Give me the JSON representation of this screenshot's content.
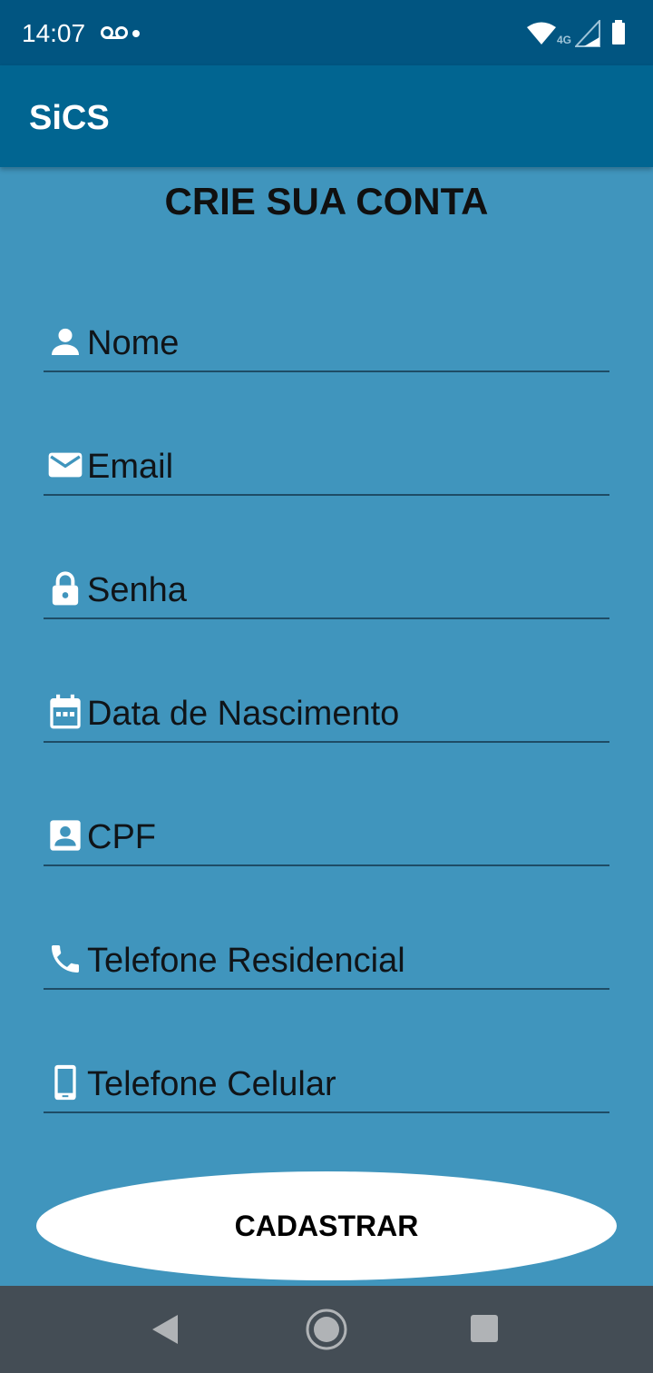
{
  "status_bar": {
    "time": "14:07",
    "network_label": "4G",
    "icons": [
      "voicemail-icon",
      "notification-dot",
      "wifi-icon",
      "signal-icon",
      "battery-icon"
    ]
  },
  "app_bar": {
    "title": "SiCS"
  },
  "form": {
    "heading": "CRIE SUA CONTA",
    "fields": [
      {
        "label": "Nome",
        "icon": "person-icon"
      },
      {
        "label": "Email",
        "icon": "email-icon"
      },
      {
        "label": "Senha",
        "icon": "lock-icon"
      },
      {
        "label": "Data de Nascimento",
        "icon": "calendar-icon"
      },
      {
        "label": "CPF",
        "icon": "id-card-icon"
      },
      {
        "label": "Telefone Residencial",
        "icon": "phone-icon"
      },
      {
        "label": "Telefone Celular",
        "icon": "smartphone-icon"
      }
    ],
    "submit_label": "CADASTRAR"
  },
  "nav_bar": {
    "icons": [
      "back-icon",
      "home-icon",
      "recents-icon"
    ]
  },
  "colors": {
    "background": "#4095bd",
    "status_bar": "#015581",
    "app_bar": "#016591",
    "field_underline": "#1e4c66",
    "nav_bar": "#444d55",
    "button_background": "#ffffff"
  }
}
